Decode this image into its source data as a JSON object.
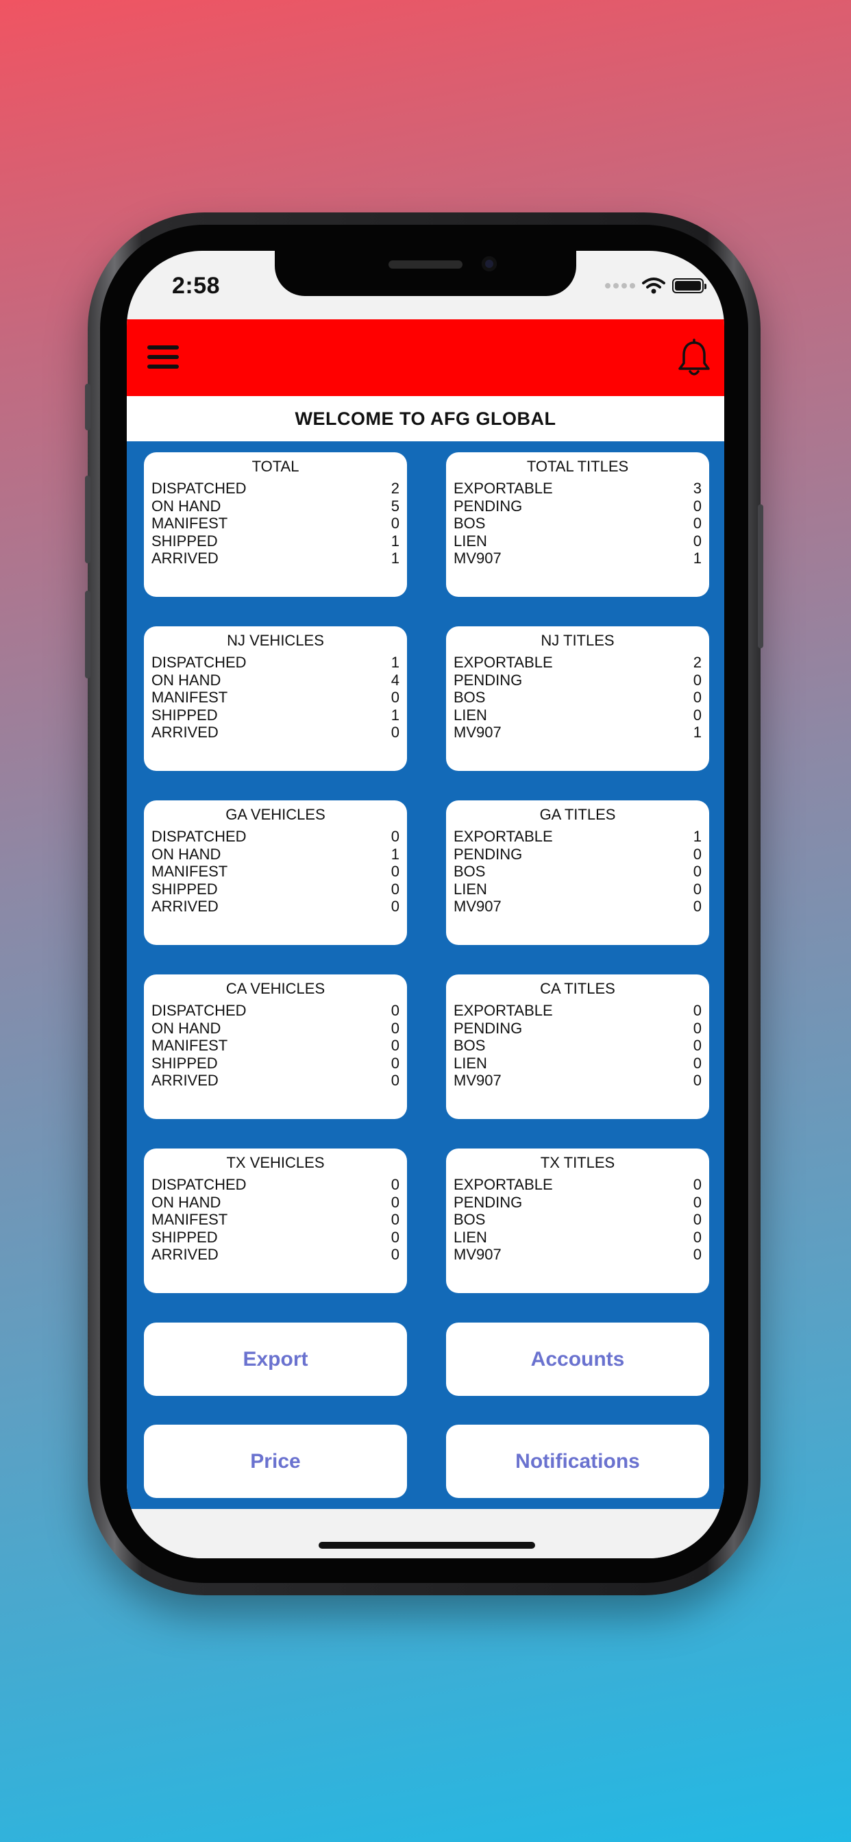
{
  "status_bar": {
    "time": "2:58"
  },
  "header": {
    "title": "WELCOME TO AFG GLOBAL"
  },
  "cards": [
    {
      "title": "TOTAL",
      "rows": [
        {
          "label": "DISPATCHED",
          "value": "2"
        },
        {
          "label": "ON HAND",
          "value": "5"
        },
        {
          "label": "MANIFEST",
          "value": "0"
        },
        {
          "label": "SHIPPED",
          "value": "1"
        },
        {
          "label": "ARRIVED",
          "value": "1"
        }
      ]
    },
    {
      "title": "TOTAL TITLES",
      "rows": [
        {
          "label": "EXPORTABLE",
          "value": "3"
        },
        {
          "label": "PENDING",
          "value": "0"
        },
        {
          "label": "BOS",
          "value": "0"
        },
        {
          "label": "LIEN",
          "value": "0"
        },
        {
          "label": "MV907",
          "value": "1"
        }
      ]
    },
    {
      "title": "NJ VEHICLES",
      "rows": [
        {
          "label": "DISPATCHED",
          "value": "1"
        },
        {
          "label": "ON HAND",
          "value": "4"
        },
        {
          "label": "MANIFEST",
          "value": "0"
        },
        {
          "label": "SHIPPED",
          "value": "1"
        },
        {
          "label": "ARRIVED",
          "value": "0"
        }
      ]
    },
    {
      "title": "NJ TITLES",
      "rows": [
        {
          "label": "EXPORTABLE",
          "value": "2"
        },
        {
          "label": "PENDING",
          "value": "0"
        },
        {
          "label": "BOS",
          "value": "0"
        },
        {
          "label": "LIEN",
          "value": "0"
        },
        {
          "label": "MV907",
          "value": "1"
        }
      ]
    },
    {
      "title": "GA VEHICLES",
      "rows": [
        {
          "label": "DISPATCHED",
          "value": "0"
        },
        {
          "label": "ON HAND",
          "value": "1"
        },
        {
          "label": "MANIFEST",
          "value": "0"
        },
        {
          "label": "SHIPPED",
          "value": "0"
        },
        {
          "label": "ARRIVED",
          "value": "0"
        }
      ]
    },
    {
      "title": "GA TITLES",
      "rows": [
        {
          "label": "EXPORTABLE",
          "value": "1"
        },
        {
          "label": "PENDING",
          "value": "0"
        },
        {
          "label": "BOS",
          "value": "0"
        },
        {
          "label": "LIEN",
          "value": "0"
        },
        {
          "label": "MV907",
          "value": "0"
        }
      ]
    },
    {
      "title": "CA VEHICLES",
      "rows": [
        {
          "label": "DISPATCHED",
          "value": "0"
        },
        {
          "label": "ON HAND",
          "value": "0"
        },
        {
          "label": "MANIFEST",
          "value": "0"
        },
        {
          "label": "SHIPPED",
          "value": "0"
        },
        {
          "label": "ARRIVED",
          "value": "0"
        }
      ]
    },
    {
      "title": "CA TITLES",
      "rows": [
        {
          "label": "EXPORTABLE",
          "value": "0"
        },
        {
          "label": "PENDING",
          "value": "0"
        },
        {
          "label": "BOS",
          "value": "0"
        },
        {
          "label": "LIEN",
          "value": "0"
        },
        {
          "label": "MV907",
          "value": "0"
        }
      ]
    },
    {
      "title": "TX VEHICLES",
      "rows": [
        {
          "label": "DISPATCHED",
          "value": "0"
        },
        {
          "label": "ON HAND",
          "value": "0"
        },
        {
          "label": "MANIFEST",
          "value": "0"
        },
        {
          "label": "SHIPPED",
          "value": "0"
        },
        {
          "label": "ARRIVED",
          "value": "0"
        }
      ]
    },
    {
      "title": "TX TITLES",
      "rows": [
        {
          "label": "EXPORTABLE",
          "value": "0"
        },
        {
          "label": "PENDING",
          "value": "0"
        },
        {
          "label": "BOS",
          "value": "0"
        },
        {
          "label": "LIEN",
          "value": "0"
        },
        {
          "label": "MV907",
          "value": "0"
        }
      ]
    }
  ],
  "actions": {
    "export": "Export",
    "accounts": "Accounts",
    "price": "Price",
    "notifications": "Notifications"
  },
  "icons": {
    "menu": "hamburger-menu-icon",
    "bell": "bell-icon",
    "wifi": "wifi-icon",
    "battery": "battery-icon",
    "signal": "signal-icon"
  },
  "colors": {
    "header": "#ff0000",
    "content": "#136ab8",
    "action_text": "#6a72cf"
  }
}
